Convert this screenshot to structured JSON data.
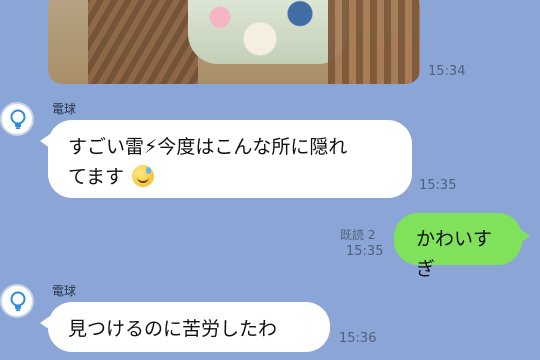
{
  "messages": {
    "image_message": {
      "time": "15:34"
    },
    "incoming_1": {
      "sender": "電球",
      "line1": "すごい雷⚡今度はこんな所に隠れ",
      "line2": "てます",
      "time": "15:35"
    },
    "outgoing_1": {
      "read": "既読 2",
      "time": "15:35",
      "text": "かわいすぎ"
    },
    "incoming_2": {
      "sender": "電球",
      "text": "見つけるのに苦労したわ",
      "time": "15:36"
    }
  },
  "icons": {
    "avatar": "lightbulb-icon",
    "emoji": "grinning-sweat-emoji"
  },
  "colors": {
    "background": "#8ba6d6",
    "incoming_bubble": "#ffffff",
    "outgoing_bubble": "#7fe25a"
  }
}
